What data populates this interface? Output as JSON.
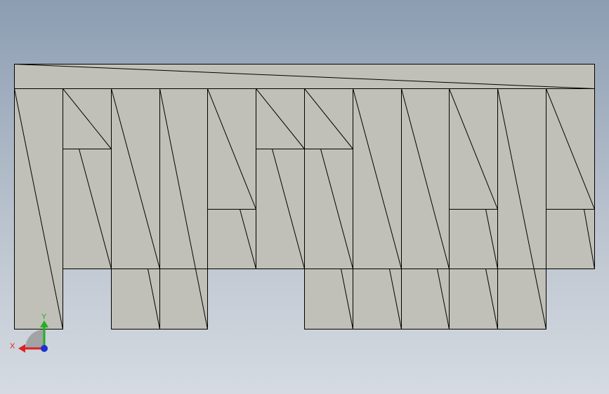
{
  "viewport": {
    "background_top": "#8c9db2",
    "background_bottom": "#d6dbe2",
    "model_fill": "#c0c0b8",
    "edge_color": "#000000"
  },
  "triad": {
    "x_label": "X",
    "y_label": "Y",
    "x_color": "#e02020",
    "y_color": "#20b020",
    "z_color": "#2030d0"
  }
}
